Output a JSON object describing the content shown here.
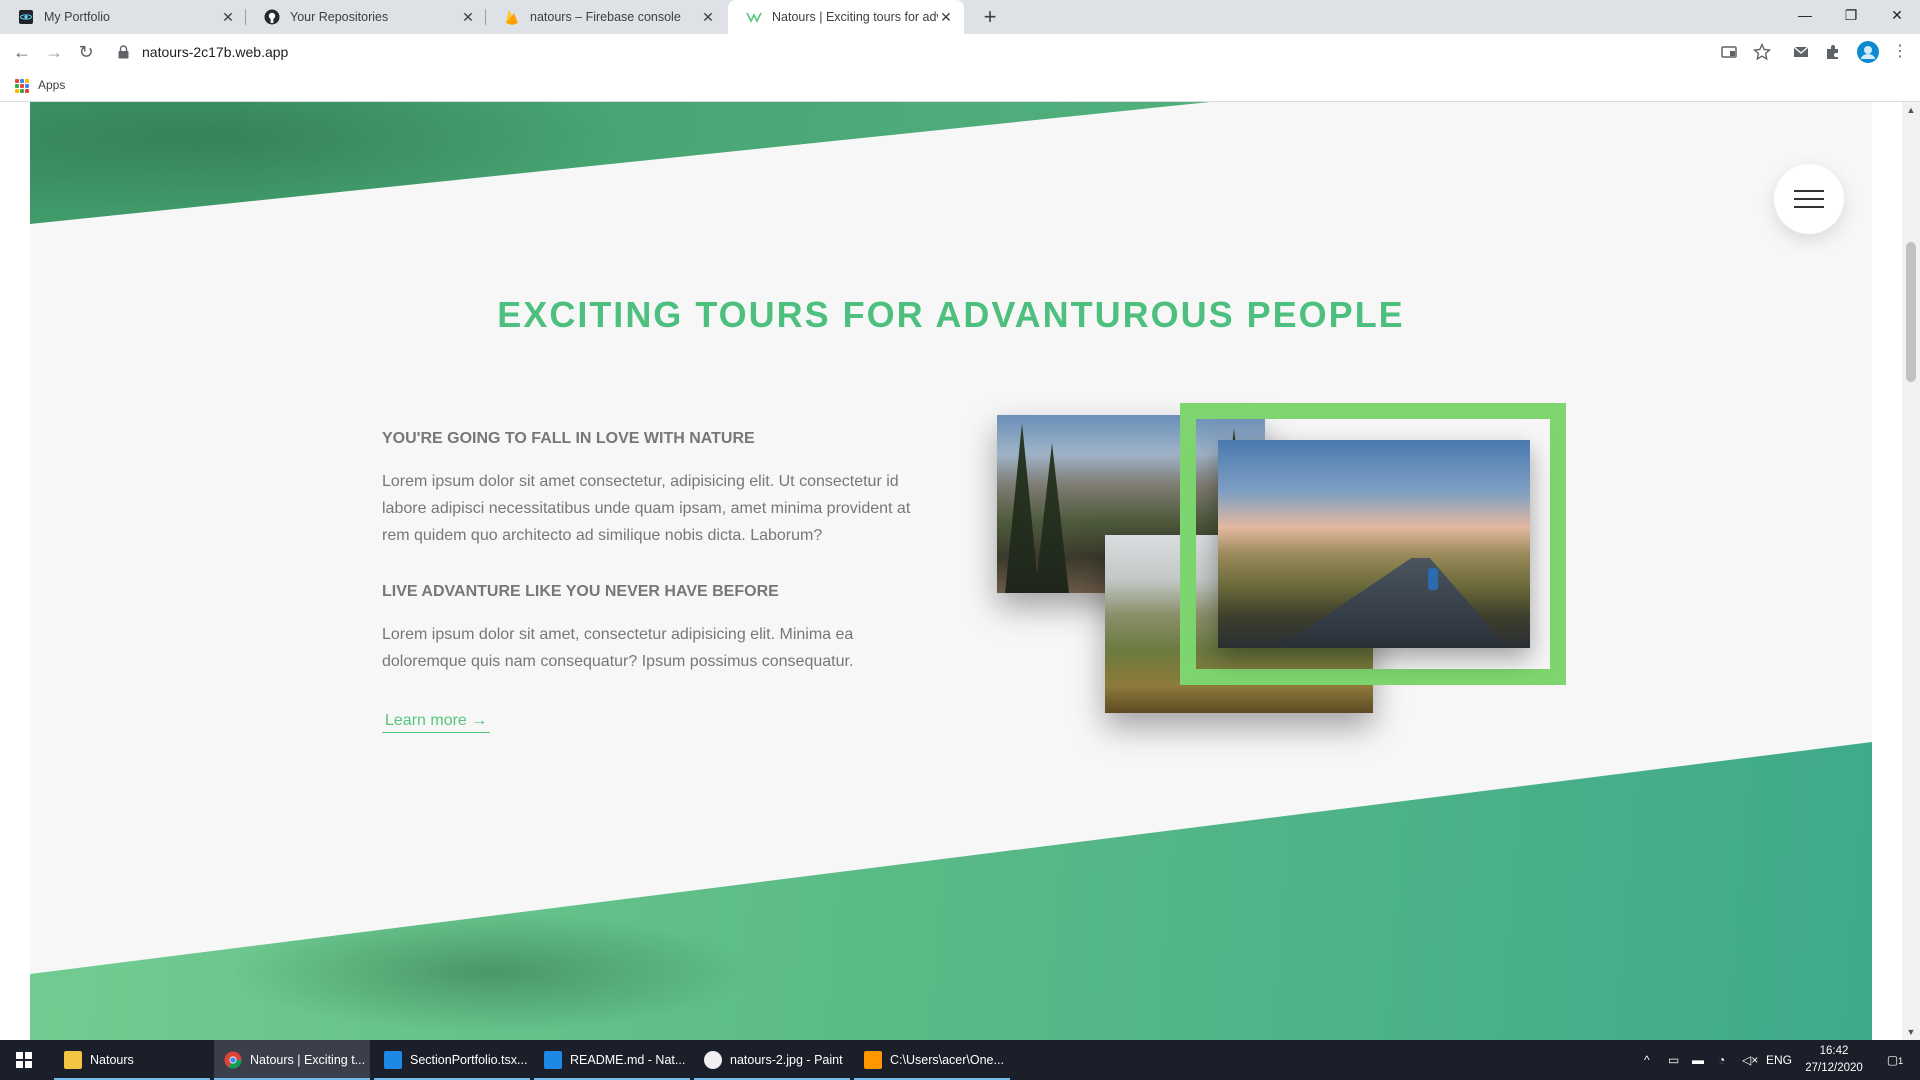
{
  "browser": {
    "tabs": [
      {
        "title": "My Portfolio",
        "icon": "react-icon"
      },
      {
        "title": "Your Repositories",
        "icon": "github-icon"
      },
      {
        "title": "natours – Firebase console",
        "icon": "firebase-icon"
      },
      {
        "title": "Natours | Exciting tours for adve",
        "icon": "natours-icon",
        "active": true
      }
    ],
    "new_tab": "+",
    "window_controls": {
      "minimize": "—",
      "restore": "❐",
      "close": "✕"
    },
    "nav": {
      "back": "←",
      "forward": "→",
      "reload": "↻"
    },
    "url": "natours-2c17b.web.app",
    "bookmarks": {
      "apps_label": "Apps"
    }
  },
  "page": {
    "section_title": "EXCITING TOURS FOR ADVANTUROUS PEOPLE",
    "features": [
      {
        "heading": "YOU'RE GOING TO FALL IN LOVE WITH NATURE",
        "text": "Lorem ipsum dolor sit amet consectetur, adipisicing elit. Ut consectetur id labore adipisci necessitatibus unde quam ipsam, amet minima provident at rem quidem quo architecto ad similique nobis dicta. Laborum?"
      },
      {
        "heading": "LIVE ADVANTURE LIKE YOU NEVER HAVE BEFORE",
        "text": "Lorem ipsum dolor sit amet, consectetur adipisicing elit. Minima ea doloremque quis nam consequatur? Ipsum possimus consequatur."
      }
    ],
    "learn_more": "Learn more →",
    "colors": {
      "primary": "#55c57a",
      "primary_light": "#7ed56f",
      "title_green": "#4dbf7e"
    }
  },
  "taskbar": {
    "items": [
      {
        "label": "Natours",
        "icon": "folder-icon"
      },
      {
        "label": "Natours | Exciting t...",
        "icon": "chrome-icon"
      },
      {
        "label": "SectionPortfolio.tsx...",
        "icon": "vscode-icon"
      },
      {
        "label": "README.md - Nat...",
        "icon": "vscode-icon"
      },
      {
        "label": "natours-2.jpg - Paint",
        "icon": "paint-icon"
      },
      {
        "label": "C:\\Users\\acer\\One...",
        "icon": "sublime-icon"
      }
    ],
    "tray": {
      "language": "ENG"
    },
    "clock": {
      "time": "16:42",
      "date": "27/12/2020"
    },
    "notification_count": "1"
  }
}
